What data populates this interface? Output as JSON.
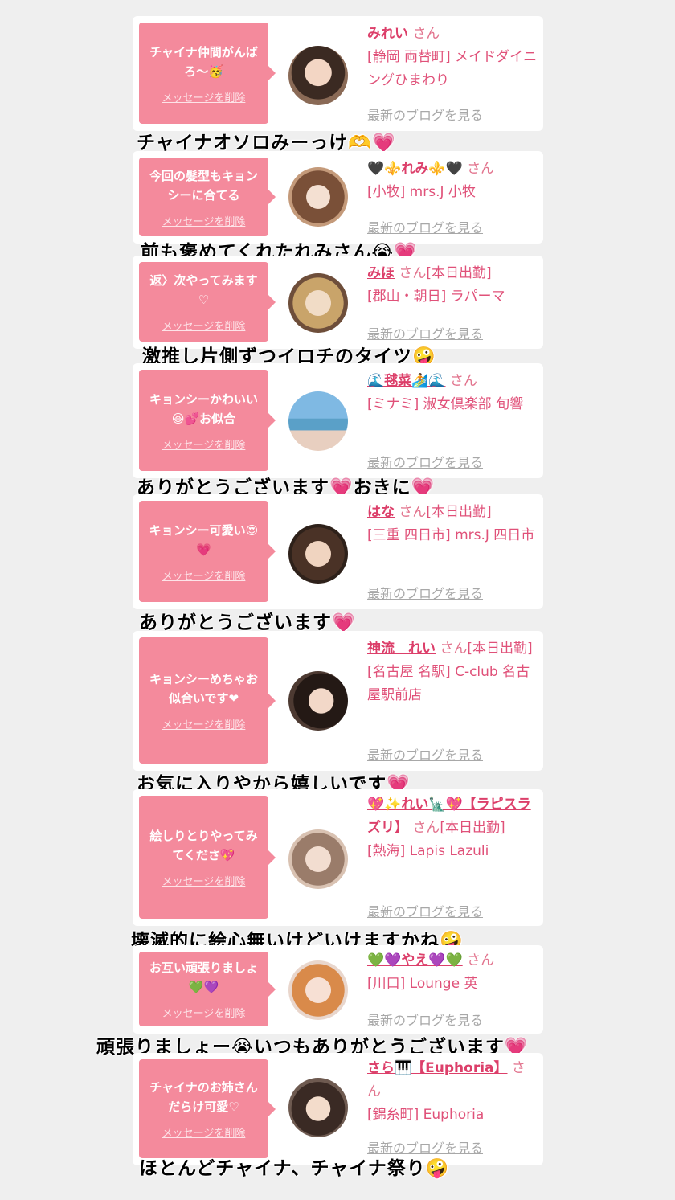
{
  "colors": {
    "background": "#efefef",
    "bubble": "#f48a9c",
    "name": "#dc3f6a",
    "blog_link": "#a8a8a8"
  },
  "cards": [
    {
      "message": "チャイナ仲間がんばろ〜🥳",
      "delete_label": "メッセージを削除",
      "name": "みれい",
      "san": "さん",
      "status": "",
      "location": "[静岡 両替町] メイドダイニングひまわり",
      "blog_label": "最新のブログを見る",
      "avatar_icon": "avatar-photo",
      "caption": "チャイナオソロみーっけ🫶💗"
    },
    {
      "message": "今回の髪型もキョンシーに合てる",
      "delete_label": "メッセージを削除",
      "name": "🖤⚜️れみ⚜️🖤",
      "san": "さん",
      "status": "",
      "location": "[小牧] mrs.J 小牧",
      "blog_label": "最新のブログを見る",
      "avatar_icon": "avatar-photo",
      "caption": "前も褒めてくれたれみさん😭💗"
    },
    {
      "message": "返〉次やってみます♡",
      "delete_label": "メッセージを削除",
      "name": "みほ",
      "san": "さん",
      "status": "[本日出勤]",
      "location": "[郡山・朝日] ラパーマ",
      "blog_label": "最新のブログを見る",
      "avatar_icon": "avatar-photo",
      "caption": "激推し片側ずつイロチのタイツ🤪"
    },
    {
      "message": "キョンシーかわいい😆💕お似合",
      "delete_label": "メッセージを削除",
      "name": "🌊毬菜🏄🌊",
      "san": "さん",
      "status": "",
      "location": "[ミナミ] 淑女倶楽部 旬響",
      "blog_label": "最新のブログを見る",
      "avatar_icon": "avatar-photo",
      "caption": "ありがとうございます💗おきに💗"
    },
    {
      "message": "キョンシー可愛い😍💗",
      "delete_label": "メッセージを削除",
      "name": "はな",
      "san": "さん",
      "status": "[本日出勤]",
      "location": "[三重 四日市] mrs.J 四日市",
      "blog_label": "最新のブログを見る",
      "avatar_icon": "avatar-photo",
      "caption": "ありがとうございます💗"
    },
    {
      "message": "キョンシーめちゃお似合いです❤",
      "delete_label": "メッセージを削除",
      "name": "神流　れい",
      "san": "さん",
      "status": "[本日出勤]",
      "location": "[名古屋 名駅] C-club 名古屋駅前店",
      "blog_label": "最新のブログを見る",
      "avatar_icon": "avatar-photo",
      "caption": "お気に入りやから嬉しいです💗"
    },
    {
      "message": "絵しりとりやってみてくださ💖",
      "delete_label": "メッセージを削除",
      "name": "💖✨れい🗽💖【ラピスラズリ】",
      "san": "さん",
      "status": "[本日出勤]",
      "location": "[熱海] Lapis Lazuli",
      "blog_label": "最新のブログを見る",
      "avatar_icon": "avatar-photo",
      "caption": "壊滅的に絵心無いけどいけますかね🤪"
    },
    {
      "message": "お互い頑張りましょ💚💜",
      "delete_label": "メッセージを削除",
      "name": "💚💜やえ💜💚",
      "san": "さん",
      "status": "",
      "location": "[川口] Lounge 英",
      "blog_label": "最新のブログを見る",
      "avatar_icon": "avatar-photo",
      "caption": "頑張りましょー😭いつもありがとうございます💗"
    },
    {
      "message": "チャイナのお姉さんだらけ可愛♡",
      "delete_label": "メッセージを削除",
      "name": "さら🎹【Euphoria】",
      "san": "さん",
      "status": "",
      "location": "[錦糸町] Euphoria",
      "blog_label": "最新のブログを見る",
      "avatar_icon": "avatar-photo",
      "caption": "ほとんどチャイナ、チャイナ祭り🤪"
    }
  ]
}
